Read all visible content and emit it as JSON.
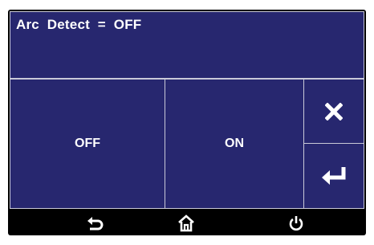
{
  "header": {
    "title": "Arc  Detect  =  OFF"
  },
  "options": {
    "off_label": "OFF",
    "on_label": "ON"
  },
  "icons": {
    "cancel": "close-icon",
    "enter": "enter-icon",
    "back": "back-arrow-icon",
    "home": "home-icon",
    "power": "power-icon"
  },
  "colors": {
    "panel": "#27276f",
    "border": "#c9c9d8",
    "background": "#000000",
    "text": "#ffffff"
  }
}
